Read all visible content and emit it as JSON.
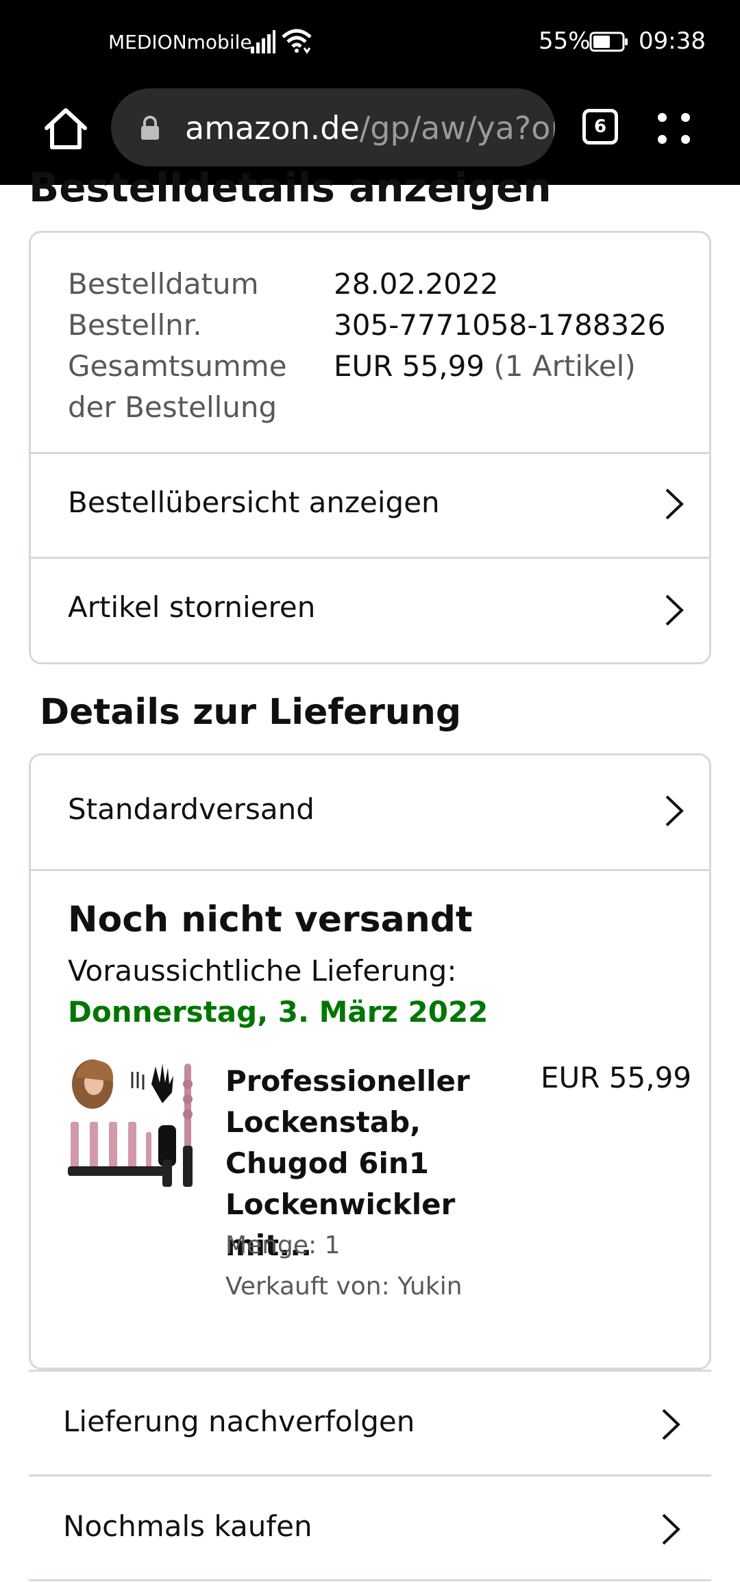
{
  "status_bar": {
    "carrier": "MEDIONmobile",
    "battery_percent": "55%",
    "time": "09:38"
  },
  "browser": {
    "url_host": "amazon.de",
    "url_path": "/gp/aw/ya?oi",
    "tab_count": "6"
  },
  "page": {
    "title": "Bestelldetails anzeigen"
  },
  "order_summary": {
    "date_label": "Bestelldatum",
    "date_value": "28.02.2022",
    "number_label": "Bestellnr.",
    "number_value": "305-7771058-1788326",
    "total_label_line1": "Gesamtsumme",
    "total_label_line2": "der Bestellung",
    "total_value": "EUR 55,99",
    "total_items": "(1 Artikel)",
    "links": [
      {
        "label": "Bestellübersicht anzeigen"
      },
      {
        "label": "Artikel stornieren"
      }
    ]
  },
  "delivery": {
    "section_title": "Details zur Lieferung",
    "shipping_method": "Standardversand",
    "status": "Noch nicht versandt",
    "eta_label": "Voraussichtliche Lieferung:",
    "eta_date": "Donnerstag, 3. März 2022",
    "eta_color": "#007600",
    "product": {
      "name": "Professioneller Lockenstab, Chugod 6in1 Lockenwickler mit...",
      "price": "EUR 55,99",
      "quantity": "Menge: 1",
      "seller": "Verkauft von: Yukin"
    }
  },
  "actions": [
    {
      "label": "Lieferung nachverfolgen"
    },
    {
      "label": "Nochmals kaufen"
    }
  ],
  "icons": {
    "chevron": "chevron-right-icon",
    "home": "home-icon",
    "lock": "lock-icon",
    "menu": "more-menu-icon"
  }
}
